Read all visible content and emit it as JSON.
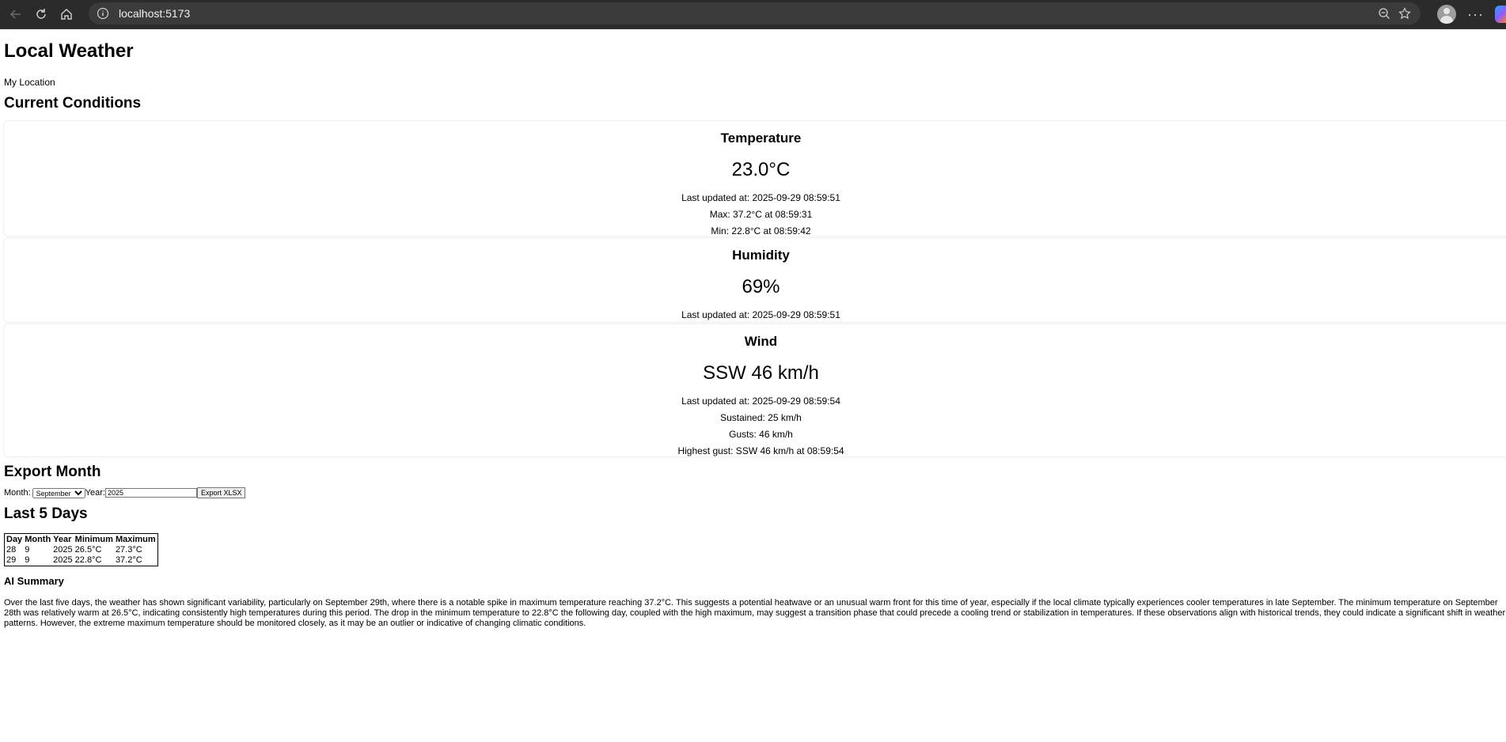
{
  "browser": {
    "url": "localhost:5173"
  },
  "page": {
    "title": "Local Weather",
    "location": "My Location",
    "current_heading": "Current Conditions"
  },
  "temperature": {
    "heading": "Temperature",
    "value": "23.0°C",
    "updated": "Last updated at: 2025-09-29 08:59:51",
    "max": "Max: 37.2°C at 08:59:31",
    "min": "Min: 22.8°C at 08:59:42"
  },
  "humidity": {
    "heading": "Humidity",
    "value": "69%",
    "updated": "Last updated at: 2025-09-29 08:59:51"
  },
  "wind": {
    "heading": "Wind",
    "value": "SSW 46 km/h",
    "updated": "Last updated at: 2025-09-29 08:59:54",
    "sustained": "Sustained: 25 km/h",
    "gusts": "Gusts: 46 km/h",
    "highest": "Highest gust: SSW 46 km/h at 08:59:54"
  },
  "export": {
    "heading": "Export Month",
    "month_label": "Month:",
    "month_value": "September",
    "year_label": "Year:",
    "year_value": "2025",
    "button": "Export XLSX"
  },
  "last5": {
    "heading": "Last 5 Days",
    "headers": [
      "Day",
      "Month",
      "Year",
      "Minimum",
      "Maximum"
    ],
    "rows": [
      [
        "28",
        "9",
        "2025",
        "26.5°C",
        "27.3°C"
      ],
      [
        "29",
        "9",
        "2025",
        "22.8°C",
        "37.2°C"
      ]
    ]
  },
  "ai": {
    "heading": "AI Summary",
    "text": "Over the last five days, the weather has shown significant variability, particularly on September 29th, where there is a notable spike in maximum temperature reaching 37.2°C. This suggests a potential heatwave or an unusual warm front for this time of year, especially if the local climate typically experiences cooler temperatures in late September. The minimum temperature on September 28th was relatively warm at 26.5°C, indicating consistently high temperatures during this period. The drop in the minimum temperature to 22.8°C the following day, coupled with the high maximum, may suggest a transition phase that could precede a cooling trend or stabilization in temperatures. If these observations align with historical trends, they could indicate a significant shift in weather patterns. However, the extreme maximum temperature should be monitored closely, as it may be an outlier or indicative of changing climatic conditions."
  },
  "icons": [
    "back-icon",
    "reload-icon",
    "home-icon",
    "info-icon",
    "zoom-out-icon",
    "star-icon",
    "profile-icon",
    "more-icon",
    "copilot-icon"
  ]
}
